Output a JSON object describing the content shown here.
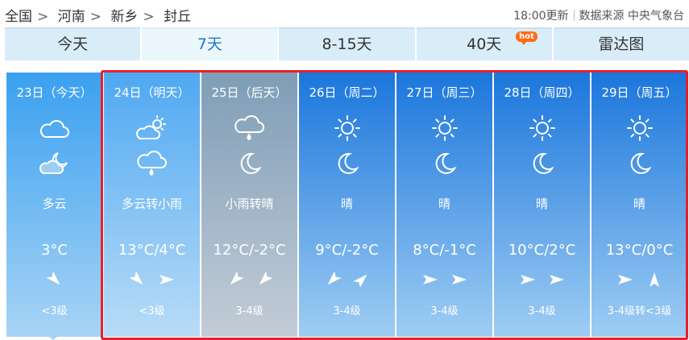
{
  "breadcrumb": {
    "items": [
      "全国",
      "河南",
      "新乡",
      "封丘"
    ],
    "sep": ">"
  },
  "header": {
    "updated": "18:00更新",
    "source": "数据来源 中央气象台"
  },
  "tabs": [
    {
      "label": "今天",
      "active": false
    },
    {
      "label": "7天",
      "active": true
    },
    {
      "label": "8-15天",
      "active": false
    },
    {
      "label": "40天",
      "active": false,
      "badge": "hot"
    },
    {
      "label": "雷达图",
      "active": false
    }
  ],
  "days": [
    {
      "date": "23日（今天）",
      "icon1": "cloudy-icon",
      "icon2": "cloudy-night-icon",
      "weather": "多云",
      "temp": "3°C",
      "wind_dirs": [
        "southeast"
      ],
      "wind_level": "<3级"
    },
    {
      "date": "24日（明天）",
      "icon1": "partly-cloudy-icon",
      "icon2": "rain-icon",
      "weather": "多云转小雨",
      "temp": "13°C/4°C",
      "wind_dirs": [
        "southeast",
        "east"
      ],
      "wind_level": "<3级"
    },
    {
      "date": "25日（后天）",
      "icon1": "rain-icon",
      "icon2": "moon-icon",
      "weather": "小雨转晴",
      "temp": "12°C/-2°C",
      "wind_dirs": [
        "southwest",
        "southwest"
      ],
      "wind_level": "3-4级"
    },
    {
      "date": "26日（周二）",
      "icon1": "sun-icon",
      "icon2": "moon-icon",
      "weather": "晴",
      "temp": "9°C/-2°C",
      "wind_dirs": [
        "southwest",
        "northeast"
      ],
      "wind_level": "3-4级"
    },
    {
      "date": "27日（周三）",
      "icon1": "sun-icon",
      "icon2": "moon-icon",
      "weather": "晴",
      "temp": "8°C/-1°C",
      "wind_dirs": [
        "east",
        "east"
      ],
      "wind_level": "3-4级"
    },
    {
      "date": "28日（周四）",
      "icon1": "sun-icon",
      "icon2": "moon-icon",
      "weather": "晴",
      "temp": "10°C/2°C",
      "wind_dirs": [
        "east",
        "east"
      ],
      "wind_level": "3-4级"
    },
    {
      "date": "29日（周五）",
      "icon1": "sun-icon",
      "icon2": "moon-icon",
      "weather": "晴",
      "temp": "13°C/0°C",
      "wind_dirs": [
        "east",
        "north"
      ],
      "wind_level": "3-4级转<3级"
    }
  ],
  "colors": {
    "accent": "#1f77c8",
    "highlight_box": "#e7202a",
    "hot_badge": "#ff6b1a"
  }
}
